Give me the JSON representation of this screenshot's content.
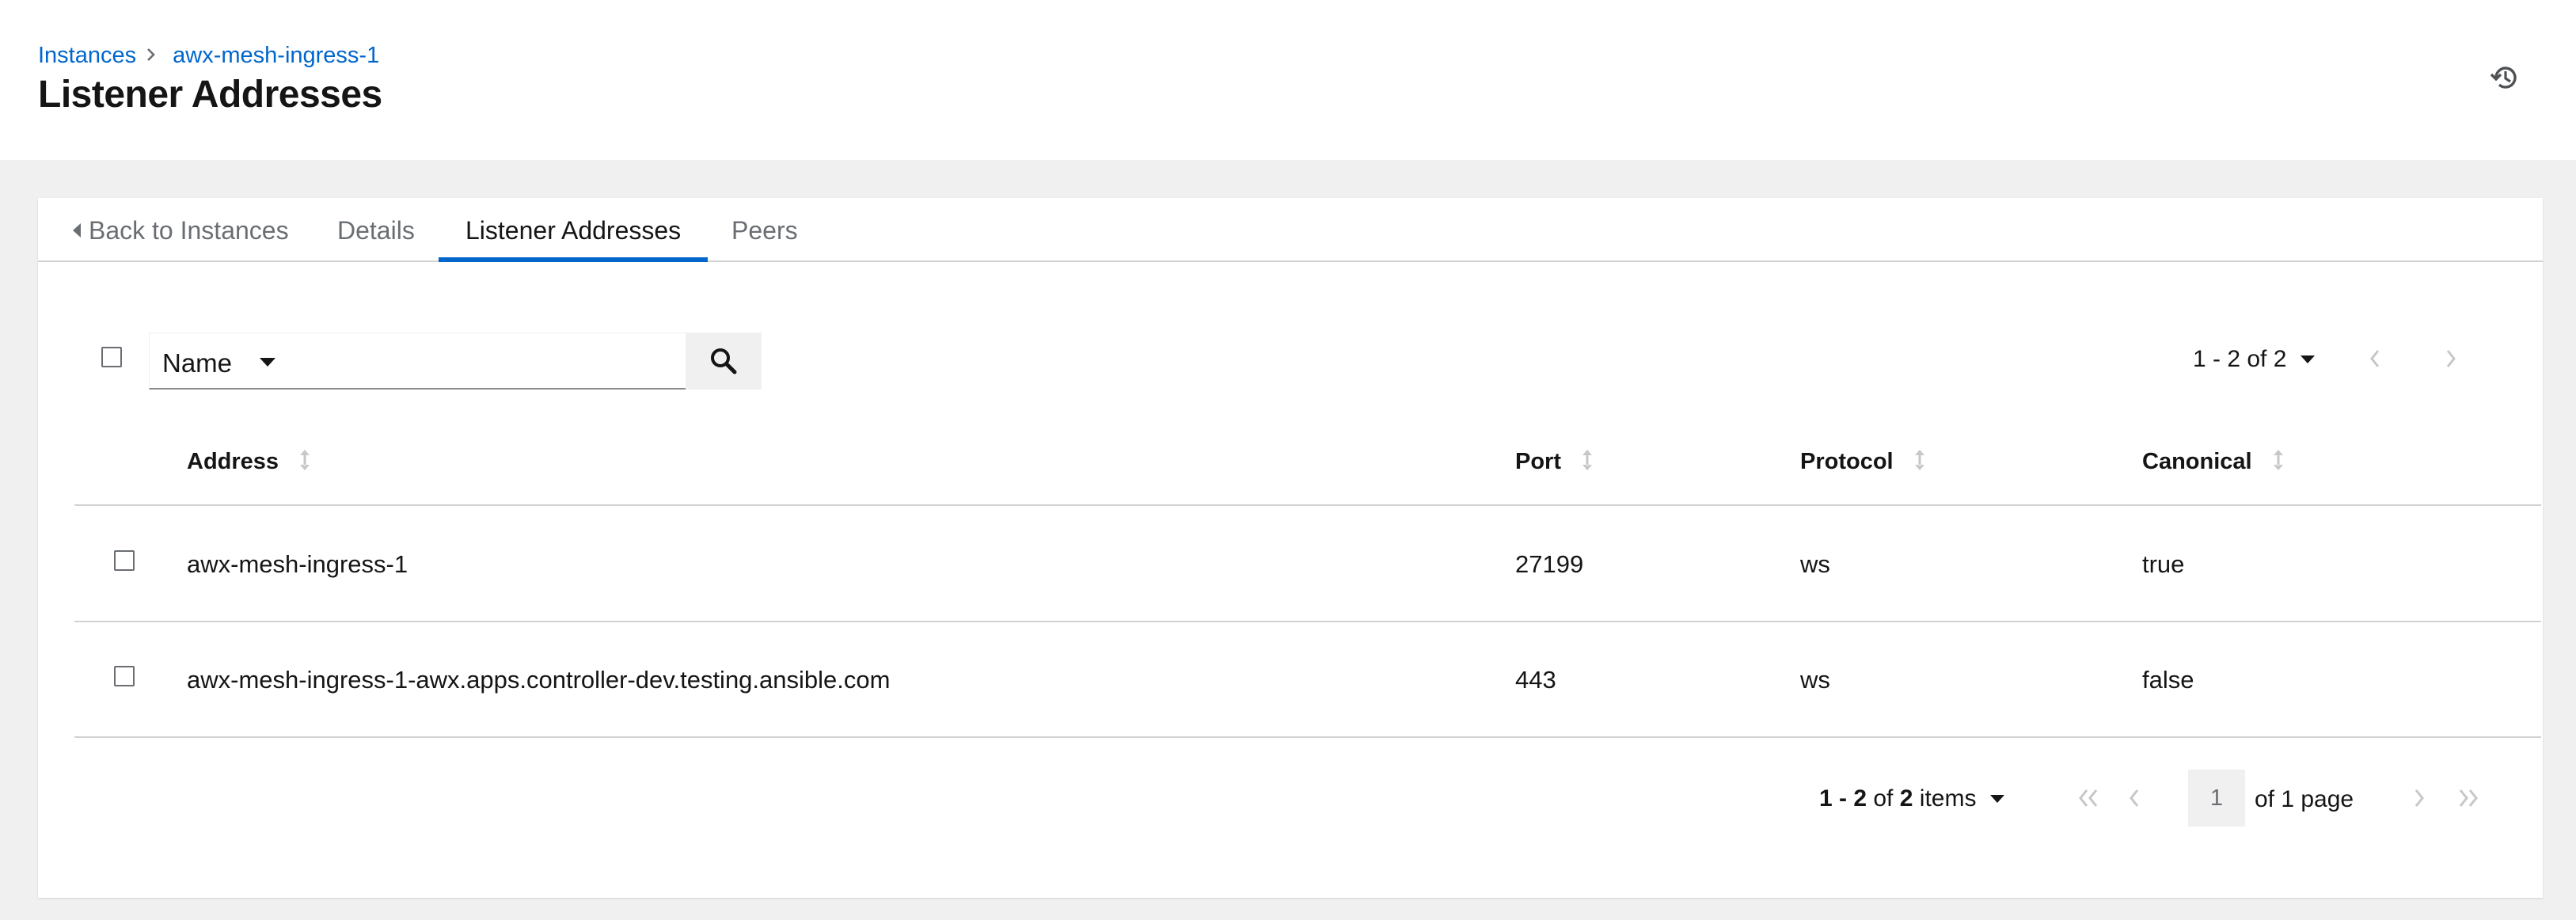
{
  "breadcrumb": {
    "items": [
      {
        "label": "Instances"
      },
      {
        "label": "awx-mesh-ingress-1"
      }
    ]
  },
  "page": {
    "title": "Listener Addresses",
    "history_icon": "history-icon"
  },
  "tabs": [
    {
      "label": "Back to Instances"
    },
    {
      "label": "Details"
    },
    {
      "label": "Listener Addresses",
      "active": true
    },
    {
      "label": "Peers"
    }
  ],
  "toolbar": {
    "filter_key": "Name",
    "search_value": "",
    "pagination_label": "1 - 2 of 2"
  },
  "table": {
    "columns": [
      "Address",
      "Port",
      "Protocol",
      "Canonical"
    ],
    "rows": [
      {
        "address": "awx-mesh-ingress-1",
        "port": "27199",
        "protocol": "ws",
        "canonical": "true"
      },
      {
        "address": "awx-mesh-ingress-1-awx.apps.controller-dev.testing.ansible.com",
        "port": "443",
        "protocol": "ws",
        "canonical": "false"
      }
    ]
  },
  "pagination": {
    "range": "1 - 2",
    "of": "of",
    "total": "2",
    "items_label": "items",
    "current_page": "1",
    "of_pages": "of 1 page"
  },
  "colors": {
    "link": "#0066cc",
    "tab_active": "#0066cc",
    "text": "#151515",
    "muted": "#6a6e73",
    "background": "#f0f0f0"
  }
}
